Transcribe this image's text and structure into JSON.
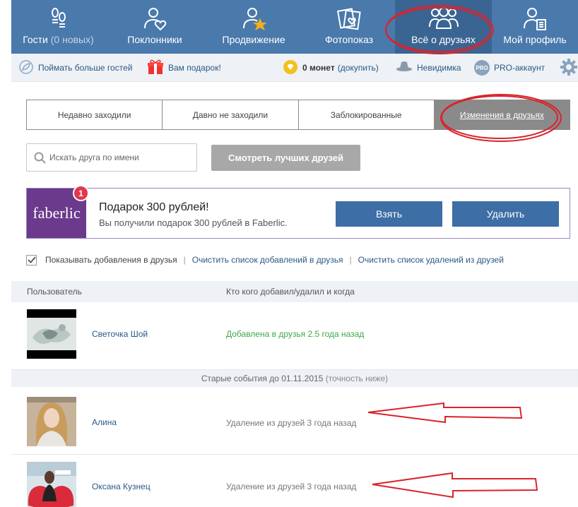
{
  "nav": {
    "items": [
      {
        "label": "Гости",
        "extra": "(0 новых)",
        "icon": "footprints-icon"
      },
      {
        "label": "Поклонники",
        "icon": "person-heart-icon"
      },
      {
        "label": "Продвижение",
        "icon": "person-star-icon"
      },
      {
        "label": "Фотопоказ",
        "icon": "photos-heart-icon"
      },
      {
        "label": "Всё о друзьях",
        "icon": "friends-icon"
      },
      {
        "label": "Мой профиль",
        "icon": "profile-icon"
      }
    ],
    "active_index": 4
  },
  "toolbar": {
    "catch_guests": "Поймать больше гостей",
    "gift": "Вам подарок!",
    "coins_value": "0 монет",
    "coins_buy": "(докупить)",
    "invisible": "Невидимка",
    "pro_badge": "PRO",
    "pro_account": "PRO-аккаунт"
  },
  "tabs": [
    {
      "label": "Недавно заходили"
    },
    {
      "label": "Давно не заходили"
    },
    {
      "label": "Заблокированные"
    },
    {
      "label": "Изменения в друзьях",
      "active": true
    }
  ],
  "search": {
    "placeholder": "Искать друга по имени"
  },
  "best_friends_button": "Смотреть лучших друзей",
  "promo": {
    "logo_text": "faberlic",
    "badge": "1",
    "title": "Подарок 300 рублей!",
    "subtitle": "Вы получили подарок 300 рублей в Faberlic.",
    "accept": "Взять",
    "delete": "Удалить"
  },
  "options": {
    "show_additions": "Показывать добавления в друзья",
    "show_additions_checked": true,
    "clear_additions": "Очистить список добавлений в друзья",
    "clear_removals": "Очистить список удалений из друзей",
    "separator": "|"
  },
  "table": {
    "col_user": "Пользователь",
    "col_action": "Кто кого добавил/удалил и когда",
    "rows": [
      {
        "name": "Светочка Шой",
        "action": "Добавлена в друзья 2.5 года назад",
        "type": "added"
      }
    ],
    "old_events": {
      "label": "Старые события до 01.11.2015",
      "note": "(точность ниже)"
    },
    "old_rows": [
      {
        "name": "Алина",
        "action": "Удаление из друзей 3 года назад",
        "type": "removed"
      },
      {
        "name": "Оксана Кузнец",
        "action": "Удаление из друзей 3 года назад",
        "type": "removed"
      }
    ]
  },
  "colors": {
    "nav_bg": "#4a79ab",
    "link": "#2a5885",
    "added": "#3ea84a",
    "removed": "#777777",
    "annotation": "#d8242c",
    "promo_logo_bg": "#6b3a8c"
  }
}
